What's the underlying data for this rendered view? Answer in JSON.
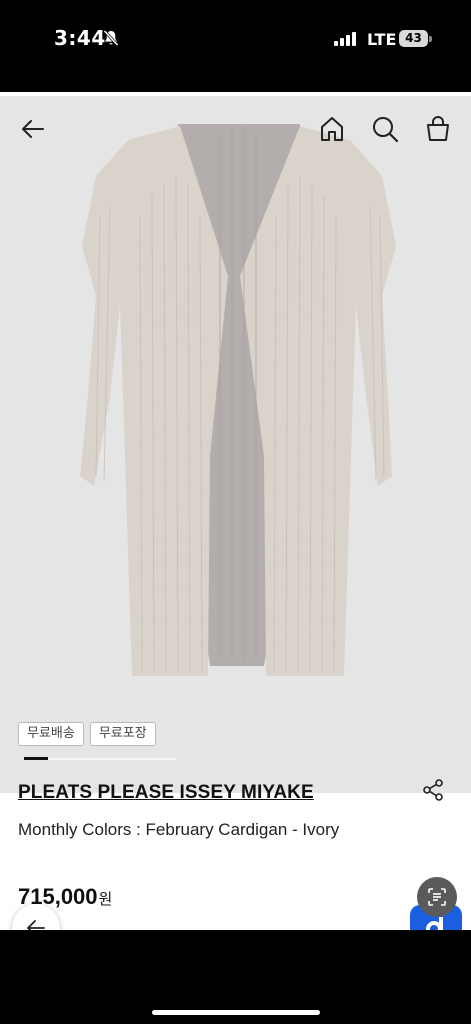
{
  "status_bar": {
    "time": "3:44",
    "network": "LTE",
    "battery": "43",
    "icons": [
      "bell-slash-icon",
      "signal-icon",
      "battery-icon"
    ]
  },
  "header": {
    "icons": [
      "arrow-left-icon",
      "home-icon",
      "search-icon",
      "shopping-bag-icon"
    ]
  },
  "carousel": {
    "current_index": 1,
    "progress": 0.16
  },
  "tags": [
    "무료배송",
    "무료포장"
  ],
  "product": {
    "brand": "PLEATS PLEASE ISSEY MIYAKE",
    "title": "Monthly Colors : February Cardigan - Ivory",
    "price": "715,000",
    "currency": "원"
  },
  "floating": {
    "icons": [
      "scan-text-icon",
      "chat-icon",
      "back-arrow-icon"
    ]
  },
  "colors": {
    "image_background": "#e6e5e6",
    "garment": "#d9d3cc",
    "garment_inner": "#b3aeab",
    "chat_button": "#1b5fe0",
    "scan_button": "#5a5a5a"
  }
}
